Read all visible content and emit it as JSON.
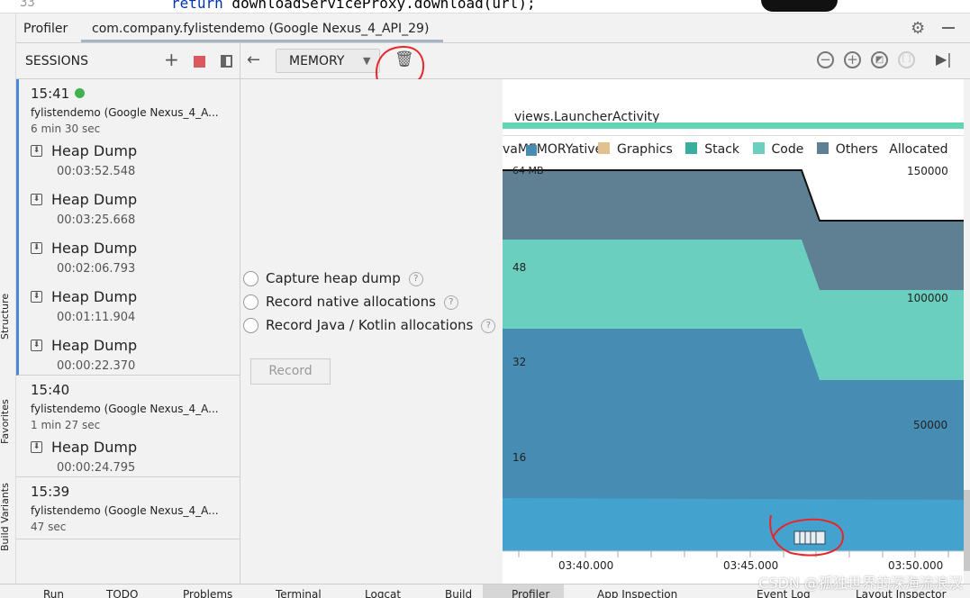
{
  "editor": {
    "line_number": "33",
    "code_keyword": "return",
    "code_rest": " downloadServiceProxy.download(url);"
  },
  "side_tabs": [
    "Structure",
    "Favorites",
    "Build Variants"
  ],
  "tabs": {
    "profiler": "Profiler",
    "session_tab": "com.company.fylistendemo (Google Nexus_4_API_29)"
  },
  "sessions_header": {
    "title": "SESSIONS"
  },
  "sessions": [
    {
      "time": "15:41",
      "active": true,
      "device": "fylistendemo (Google Nexus_4_A...",
      "duration": "6 min 30 sec",
      "heap_dumps": [
        {
          "label": "Heap Dump",
          "ts": "00:03:52.548"
        },
        {
          "label": "Heap Dump",
          "ts": "00:03:25.668"
        },
        {
          "label": "Heap Dump",
          "ts": "00:02:06.793"
        },
        {
          "label": "Heap Dump",
          "ts": "00:01:11.904"
        },
        {
          "label": "Heap Dump",
          "ts": "00:00:22.370"
        }
      ]
    },
    {
      "time": "15:40",
      "active": false,
      "device": "fylistendemo (Google Nexus_4_A...",
      "duration": "1 min 27 sec",
      "heap_dumps": [
        {
          "label": "Heap Dump",
          "ts": "00:00:24.795"
        }
      ]
    },
    {
      "time": "15:39",
      "active": false,
      "device": "fylistendemo (Google Nexus_4_A...",
      "duration": "47 sec",
      "heap_dumps": []
    }
  ],
  "toolbar": {
    "profiler_select": "MEMORY"
  },
  "options": {
    "capture": "Capture heap dump",
    "native": "Record native allocations",
    "java": "Record Java / Kotlin allocations",
    "record_button": "Record"
  },
  "chart": {
    "activity": "views.LauncherActivity",
    "legend_overlap": "vaMEMORYative",
    "legend": [
      {
        "name": "Graphics",
        "color": "#e3c08f"
      },
      {
        "name": "Stack",
        "color": "#3aae9c"
      },
      {
        "name": "Code",
        "color": "#6bcfbf"
      },
      {
        "name": "Others",
        "color": "#5f7f92"
      },
      {
        "name": "Allocated",
        "color": ""
      }
    ],
    "y_left_ticks": [
      "64 MB",
      "48",
      "32",
      "16"
    ],
    "y_right_ticks": [
      "150000",
      "100000",
      "50000"
    ],
    "x_ticks": [
      "03:40.000",
      "03:45.000",
      "03:50.000"
    ],
    "colors": {
      "java": "#478db3",
      "native": "#43a3ce",
      "code": "#6bcfbf",
      "others": "#5f7f92",
      "activity_bar": "#63d5b5"
    }
  },
  "status_bar": [
    "Run",
    "TODO",
    "Problems",
    "Terminal",
    "Logcat",
    "Build",
    "Profiler",
    "App Inspection",
    "Event Log",
    "Layout Inspector"
  ],
  "watermark": "CSDN @孤独世界的深海流浪汉"
}
